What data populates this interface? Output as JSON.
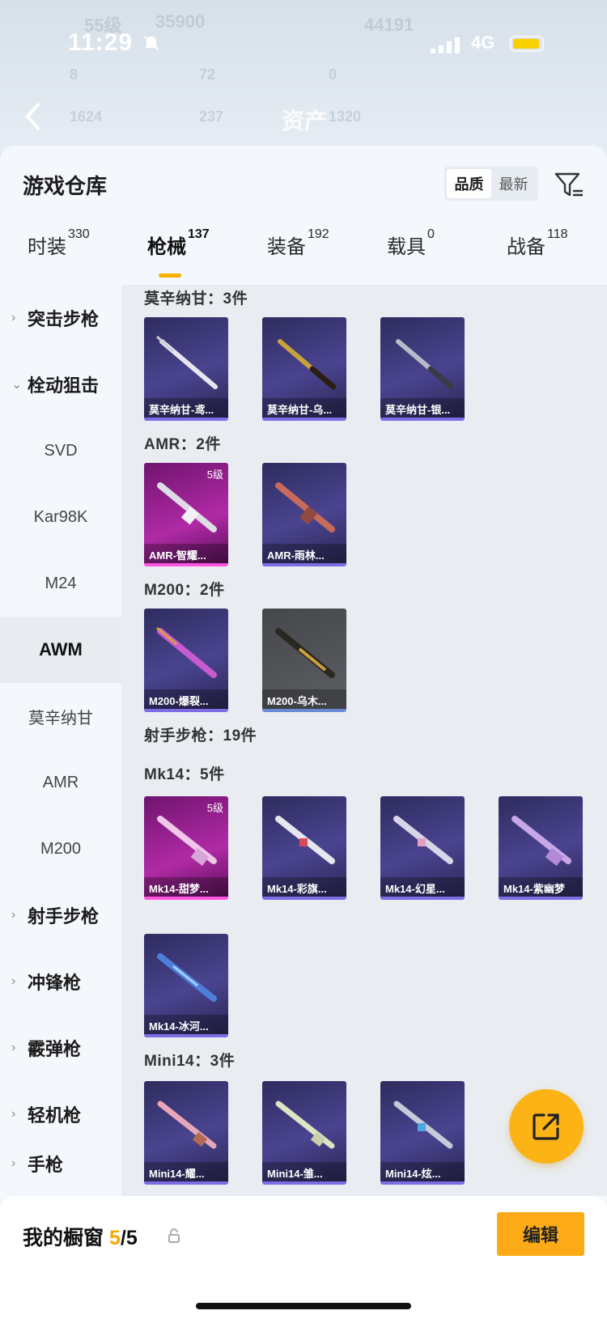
{
  "status": {
    "time": "11:29",
    "network": "4G"
  },
  "nav": {
    "title": "资产",
    "back_icon": "chevron-left-icon"
  },
  "bg_ghost": {
    "lines": [
      "55级",
      "35900",
      "44191",
      "8",
      "72",
      "0",
      "1624",
      "237",
      "1320"
    ]
  },
  "header": {
    "title": "游戏仓库",
    "sort_quality": "品质",
    "sort_newest": "最新",
    "filter_icon": "filter-icon"
  },
  "tabs": [
    {
      "label": "时装",
      "count": "330"
    },
    {
      "label": "枪械",
      "count": "137"
    },
    {
      "label": "装备",
      "count": "192"
    },
    {
      "label": "载具",
      "count": "0"
    },
    {
      "label": "战备",
      "count": "118"
    }
  ],
  "sidebar": {
    "items": [
      {
        "label": "突击步枪"
      },
      {
        "label": "栓动狙击"
      },
      {
        "label": "SVD"
      },
      {
        "label": "Kar98K"
      },
      {
        "label": "M24"
      },
      {
        "label": "AWM"
      },
      {
        "label": "莫辛纳甘"
      },
      {
        "label": "AMR"
      },
      {
        "label": "M200"
      },
      {
        "label": "射手步枪"
      },
      {
        "label": "冲锋枪"
      },
      {
        "label": "霰弹枪"
      },
      {
        "label": "轻机枪"
      },
      {
        "label": "手枪"
      }
    ]
  },
  "groups": {
    "mosin": {
      "title": "莫辛纳甘：3件",
      "items": [
        {
          "name": "莫辛纳甘-鸢..."
        },
        {
          "name": "莫辛纳甘-乌..."
        },
        {
          "name": "莫辛纳甘-银..."
        }
      ]
    },
    "amr": {
      "title": "AMR：2件",
      "items": [
        {
          "name": "AMR-智耀...",
          "level": "5级"
        },
        {
          "name": "AMR-雨林..."
        }
      ]
    },
    "m200": {
      "title": "M200：2件",
      "items": [
        {
          "name": "M200-爆裂..."
        },
        {
          "name": "M200-乌木..."
        }
      ]
    },
    "marksman": {
      "title": "射手步枪：19件"
    },
    "mk14": {
      "title": "Mk14：5件",
      "items": [
        {
          "name": "Mk14-甜梦...",
          "level": "5级"
        },
        {
          "name": "Mk14-彩旗..."
        },
        {
          "name": "Mk14-幻星..."
        },
        {
          "name": "Mk14-紫幽梦"
        },
        {
          "name": "Mk14-冰河..."
        }
      ]
    },
    "mini14": {
      "title": "Mini14：3件",
      "items": [
        {
          "name": "Mini14-耀..."
        },
        {
          "name": "Mini14-雏..."
        },
        {
          "name": "Mini14-炫..."
        }
      ]
    }
  },
  "fab": {
    "icon": "share-external-icon"
  },
  "showcase": {
    "label": "我的橱窗",
    "current": "5",
    "sep_total": "/5",
    "edit": "编辑"
  },
  "colors": {
    "accent": "#fcab17",
    "purple_card": "#4a4490",
    "pink_card": "#b02aa6"
  }
}
